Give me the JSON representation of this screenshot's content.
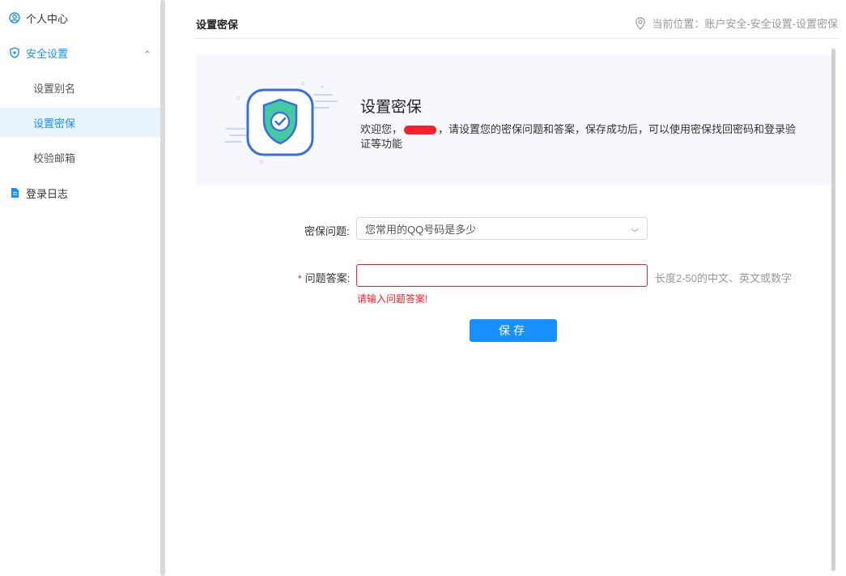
{
  "sidebar": {
    "items": [
      {
        "label": "个人中心",
        "icon": "user-circle-icon"
      },
      {
        "label": "安全设置",
        "icon": "shield-icon",
        "expanded": true
      },
      {
        "label": "设置别名"
      },
      {
        "label": "设置密保",
        "active": true
      },
      {
        "label": "校验邮箱"
      },
      {
        "label": "登录日志",
        "icon": "document-icon"
      }
    ]
  },
  "header": {
    "title": "设置密保",
    "breadcrumb": "当前位置：账户安全-安全设置-设置密保"
  },
  "banner": {
    "title": "设置密保",
    "text_before": "欢迎您，",
    "text_after": "，请设置您的密保问题和答案，保存成功后，可以使用密保找回密码和登录验证等功能"
  },
  "form": {
    "question_label": "密保问题:",
    "question_value": "您常用的QQ号码是多少",
    "answer_label": "问题答案:",
    "answer_required_mark": "*",
    "answer_value": "",
    "answer_hint": "长度2-50的中文、英文或数字",
    "answer_error": "请输入问题答案!",
    "save_label": "保存"
  },
  "colors": {
    "accent": "#1890ff",
    "error": "#f5222d",
    "active_bg": "#e8f3fc"
  }
}
